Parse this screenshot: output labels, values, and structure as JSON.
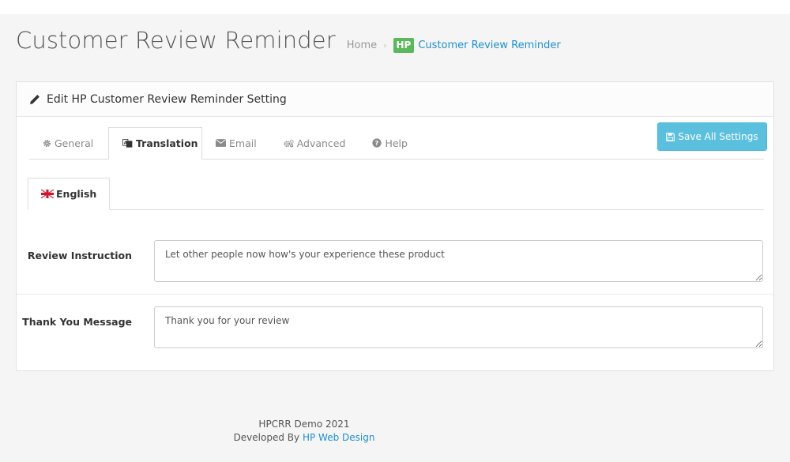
{
  "header": {
    "title": "Customer Review Reminder",
    "breadcrumb": {
      "home": "Home",
      "separator": "›",
      "logo_text": "HP",
      "current": "Customer Review Reminder"
    }
  },
  "panel": {
    "heading": "Edit HP Customer Review Reminder Setting",
    "save_button": "Save All Settings",
    "tabs": [
      {
        "label": "General",
        "icon": "gear-icon",
        "active": false
      },
      {
        "label": "Translation",
        "icon": "language-icon",
        "active": true
      },
      {
        "label": "Email",
        "icon": "envelope-icon",
        "active": false
      },
      {
        "label": "Advanced",
        "icon": "gears-icon",
        "active": false
      },
      {
        "label": "Help",
        "icon": "question-circle-icon",
        "active": false
      }
    ],
    "language_tabs": [
      {
        "label": "English",
        "icon": "uk-flag-icon",
        "active": true
      }
    ],
    "fields": [
      {
        "label": "Review Instruction",
        "value": "Let other people now how's your experience these product"
      },
      {
        "label": "Thank You Message",
        "value": "Thank you for your review"
      }
    ]
  },
  "footer": {
    "line1": "HPCRR Demo 2021",
    "developed_by": "Developed By",
    "link_text": "HP Web Design"
  },
  "colors": {
    "save_button": "#5bc0de",
    "link": "#1e91cf",
    "logo_badge": "#5cb85c"
  }
}
